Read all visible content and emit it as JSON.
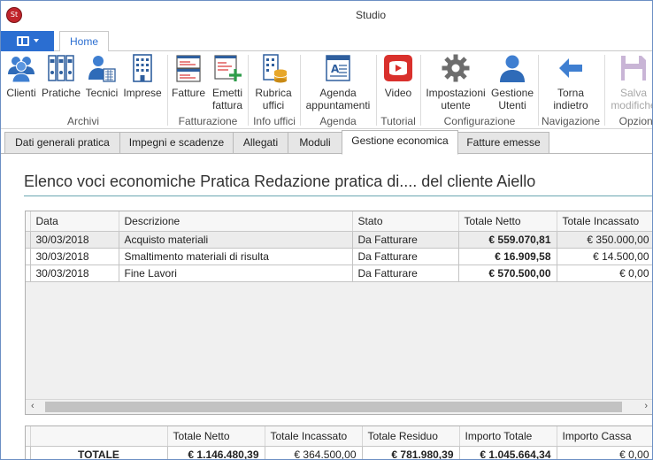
{
  "window": {
    "title": "Studio",
    "app_icon_text": "St"
  },
  "ribbon_tabs": {
    "home": "Home"
  },
  "ribbon": {
    "buttons": {
      "clienti": "Clienti",
      "pratiche": "Pratiche",
      "tecnici": "Tecnici",
      "imprese": "Imprese",
      "fatture": "Fatture",
      "emetti_fattura_1": "Emetti",
      "emetti_fattura_2": "fattura",
      "rubrica_uffici_1": "Rubrica",
      "rubrica_uffici_2": "uffici",
      "agenda_1": "Agenda",
      "agenda_2": "appuntamenti",
      "video": "Video",
      "impostazioni_1": "Impostazioni",
      "impostazioni_2": "utente",
      "gestione_utenti_1": "Gestione",
      "gestione_utenti_2": "Utenti",
      "torna_indietro_1": "Torna",
      "torna_indietro_2": "indietro",
      "salva_modifiche_1": "Salva",
      "salva_modifiche_2": "modifiche"
    },
    "groups": {
      "archivi": "Archivi",
      "fatturazione": "Fatturazione",
      "info_uffici": "Info uffici",
      "agenda": "Agenda",
      "tutorial": "Tutorial",
      "configurazione": "Configurazione",
      "navigazione": "Navigazione",
      "opzioni": "Opzioni"
    }
  },
  "doc_tabs": [
    {
      "label": "Dati generali pratica"
    },
    {
      "label": "Impegni e scadenze"
    },
    {
      "label": "Allegati"
    },
    {
      "label": "Moduli"
    },
    {
      "label": "Gestione economica"
    },
    {
      "label": "Fatture emesse"
    }
  ],
  "panel": {
    "title": "Elenco voci economiche Pratica Redazione pratica di.... del cliente Aiello"
  },
  "grid": {
    "columns": [
      "Data",
      "Descrizione",
      "Stato",
      "Totale Netto",
      "Totale Incassato"
    ],
    "rows": [
      {
        "data": "30/03/2018",
        "descrizione": "Acquisto materiali",
        "stato": "Da Fatturare",
        "totale_netto": "€ 559.070,81",
        "totale_incassato": "€ 350.000,00"
      },
      {
        "data": "30/03/2018",
        "descrizione": "Smaltimento materiali di risulta",
        "stato": "Da Fatturare",
        "totale_netto": "€ 16.909,58",
        "totale_incassato": "€ 14.500,00"
      },
      {
        "data": "30/03/2018",
        "descrizione": "Fine Lavori",
        "stato": "Da Fatturare",
        "totale_netto": "€ 570.500,00",
        "totale_incassato": "€ 0,00"
      }
    ]
  },
  "totals": {
    "columns": [
      "Totale Netto",
      "Totale Incassato",
      "Totale Residuo",
      "Importo Totale",
      "Importo Cassa"
    ],
    "row_label": "TOTALE",
    "values": {
      "totale_netto": "€ 1.146.480,39",
      "totale_incassato": "€ 364.500,00",
      "totale_residuo": "€ 781.980,39",
      "importo_totale": "€ 1.045.664,34",
      "importo_cassa": "€ 0,00"
    }
  },
  "colors": {
    "accent": "#2b6ed1",
    "youtube_red": "#d9302c",
    "title_rule": "#6aa6b0"
  }
}
